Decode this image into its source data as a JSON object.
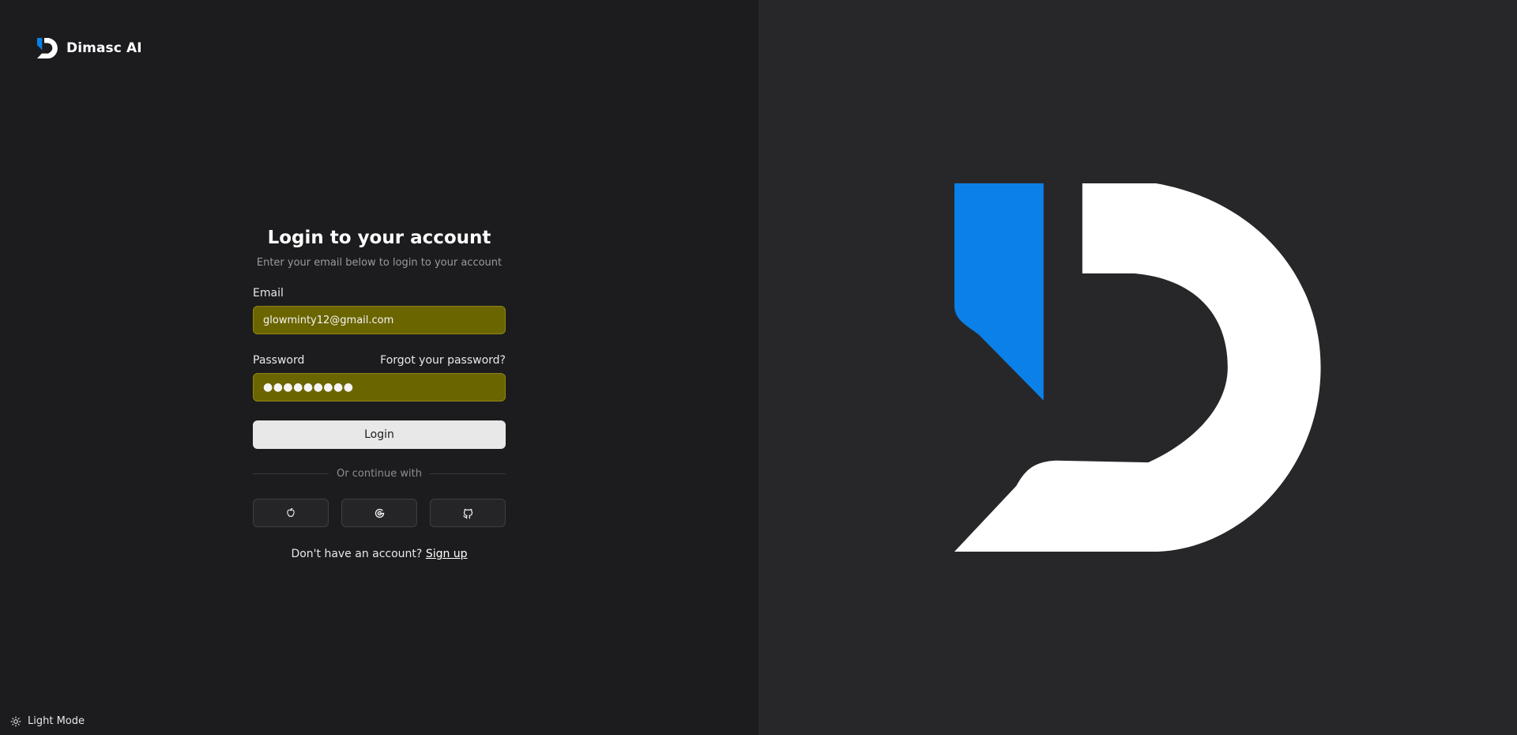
{
  "brand": {
    "name": "Dimasc AI",
    "logo_icon": "dimasc-logo-icon"
  },
  "login": {
    "title": "Login to your account",
    "subtitle": "Enter your email below to login to your account",
    "email_label": "Email",
    "email_value": "glowminty12@gmail.com",
    "password_label": "Password",
    "forgot_label": "Forgot your password?",
    "password_value": "●●●●●●●●●",
    "login_button": "Login",
    "divider_text": "Or continue with",
    "social": [
      {
        "icon": "apple-icon"
      },
      {
        "icon": "google-icon"
      },
      {
        "icon": "github-icon"
      }
    ],
    "signup_prompt": "Don't have an account?",
    "signup_link": "Sign up"
  },
  "theme_toggle": {
    "label": "Light Mode",
    "icon": "sun-icon"
  },
  "colors": {
    "left_bg": "#1c1c1e",
    "right_bg": "#27272a",
    "autofill_bg": "#6b6500",
    "logo_blue": "#0a80e8",
    "logo_white": "#ffffff"
  }
}
